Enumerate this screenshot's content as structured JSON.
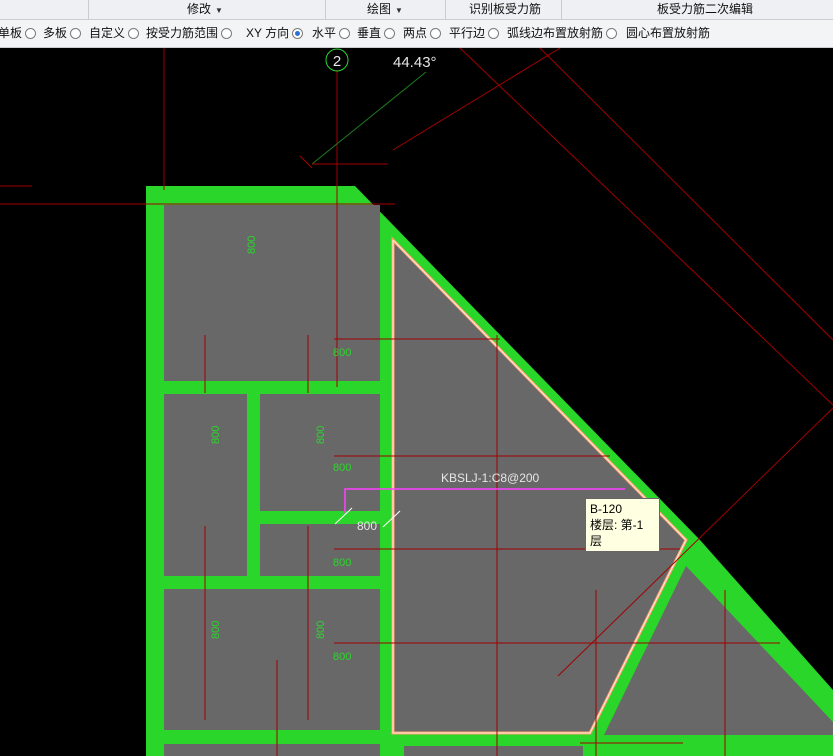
{
  "menubar": {
    "modify_label": "修改",
    "draw_label": "绘图",
    "recognize_label": "识别板受力筋",
    "secondary_edit_label": "板受力筋二次编辑"
  },
  "options": {
    "items": [
      {
        "label": "单板",
        "checked": false
      },
      {
        "label": "多板",
        "checked": false
      },
      {
        "label": "自定义",
        "checked": false
      },
      {
        "label": "按受力筋范围",
        "checked": false
      },
      {
        "label": "XY 方向",
        "checked": true
      },
      {
        "label": "水平",
        "checked": false
      },
      {
        "label": "垂直",
        "checked": false
      },
      {
        "label": "两点",
        "checked": false
      },
      {
        "label": "平行边",
        "checked": false
      },
      {
        "label": "弧线边布置放射筋",
        "checked": false
      },
      {
        "label": "圆心布置放射筋",
        "checked": false
      }
    ]
  },
  "cad": {
    "axis_number": "2",
    "angle_readout": "44.43°",
    "rebar_label": "KBSLJ-1:C8@200",
    "dimension_value": "800",
    "dim_labels": [
      "800",
      "800",
      "800",
      "800",
      "800",
      "800",
      "800",
      "800",
      "800",
      "800"
    ]
  },
  "tooltip": {
    "line1": "B-120",
    "line2": "楼层: 第-1层"
  },
  "colors": {
    "background": "#000000",
    "wall": "#2bd62b",
    "slab": "#686868",
    "grid": "#a00000",
    "rebar": "#ff40ff",
    "highlight": "#ffa070"
  }
}
